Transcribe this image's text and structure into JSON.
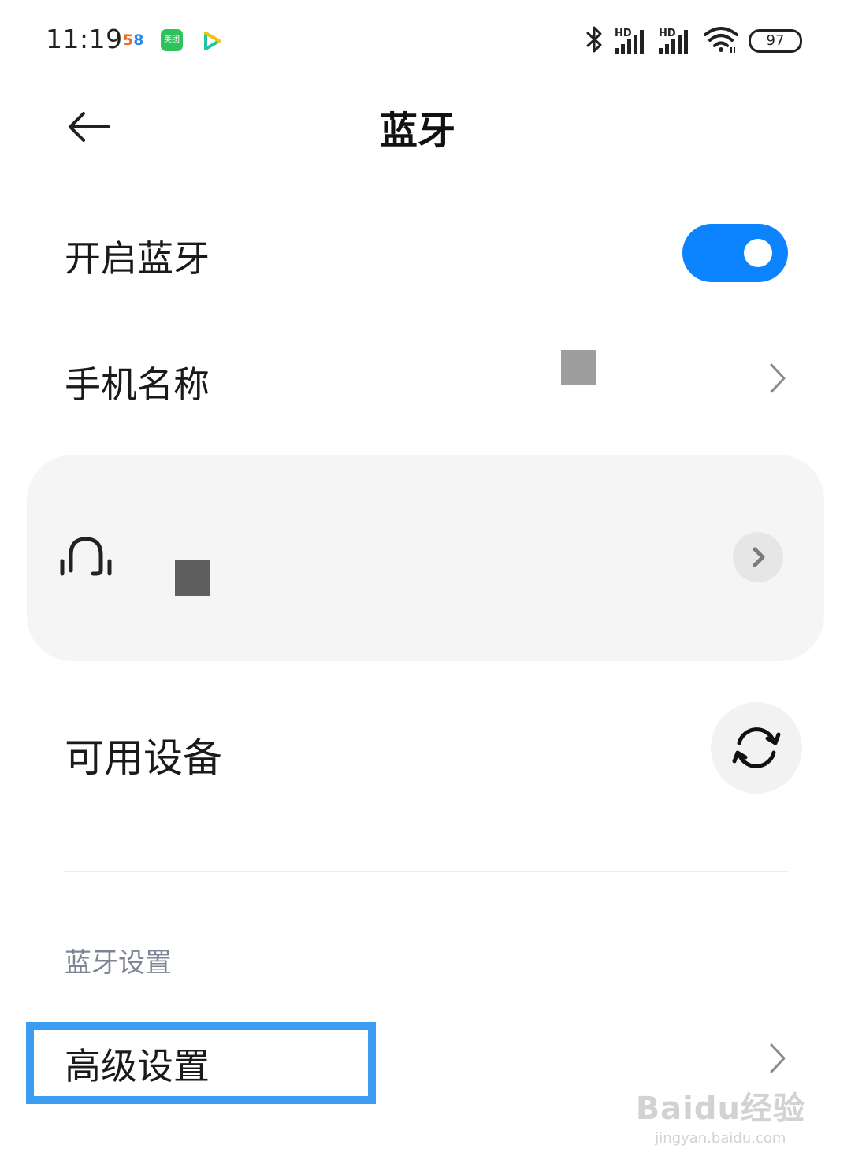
{
  "status_bar": {
    "time": "11:19",
    "notification_apps": [
      {
        "name": "58",
        "icon": "app-58-icon"
      },
      {
        "name": "美团",
        "icon": "meituan-app-icon"
      },
      {
        "name": "",
        "icon": "video-play-app-icon"
      }
    ],
    "icons": [
      "bluetooth-icon",
      "cell-signal-hd-icon",
      "cell-signal-hd-icon",
      "wifi-icon"
    ],
    "signal_label": "HD",
    "battery": "97"
  },
  "header": {
    "back_icon": "back-arrow-icon",
    "title": "蓝牙"
  },
  "bluetooth_toggle": {
    "label": "开启蓝牙",
    "on": true,
    "color": "#0d84ff"
  },
  "phone_name": {
    "label": "手机名称"
  },
  "paired_device": {
    "icon": "headset-icon"
  },
  "available_devices": {
    "label": "可用设备",
    "refresh_icon": "refresh-icon"
  },
  "settings_section": {
    "header": "蓝牙设置",
    "items": [
      {
        "label": "高级设置"
      }
    ]
  },
  "highlight_color": "#3b9cf2",
  "watermark": {
    "main": "Baidu经验",
    "sub": "jingyan.baidu.com"
  }
}
